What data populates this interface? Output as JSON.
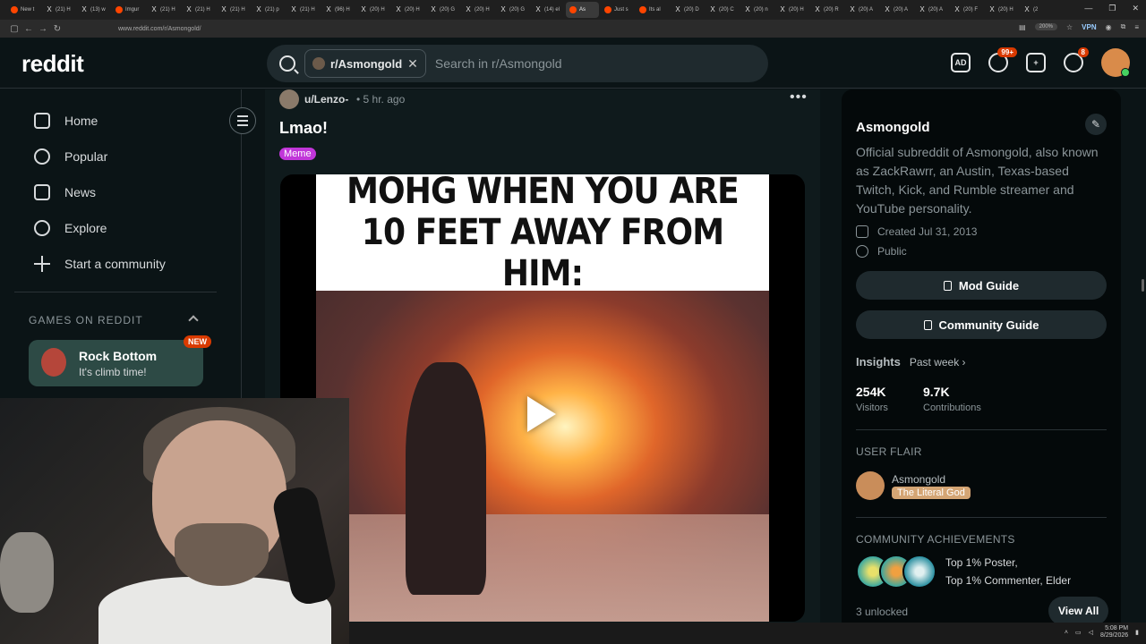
{
  "browser": {
    "tabs": [
      "New t",
      "(21) H",
      "(13) w",
      "Imgur",
      "(21) H",
      "(21) H",
      "(21) H",
      "(21) p",
      "(21) H",
      "(96) H",
      "(20) H",
      "(20) H",
      "(20) G",
      "(20) H",
      "(20) G",
      "(14) el",
      "As",
      "Just s",
      "Its al",
      "(20) D",
      "(20) C",
      "(20) n",
      "(20) H",
      "(20) R",
      "(20) A",
      "(20) A",
      "(20) A",
      "(20) F",
      "(20) H",
      "(2"
    ],
    "active_tab_index": 16,
    "url": "www.reddit.com/r/Asmongold/",
    "zoom": "200%",
    "vpn_label": "VPN"
  },
  "header": {
    "logo": "reddit",
    "search_chip": "r/Asmongold",
    "search_placeholder": "Search in r/Asmongold",
    "chat_badge": "99+",
    "notif_badge": "8",
    "ads_label": "AD"
  },
  "left_nav": {
    "items": [
      {
        "label": "Home",
        "icon": "home-icon"
      },
      {
        "label": "Popular",
        "icon": "popular-icon"
      },
      {
        "label": "News",
        "icon": "news-icon"
      },
      {
        "label": "Explore",
        "icon": "explore-icon"
      },
      {
        "label": "Start a community",
        "icon": "plus-icon"
      }
    ],
    "games_section": "GAMES ON REDDIT",
    "game": {
      "title": "Rock Bottom",
      "subtitle": "It's climb time!",
      "badge": "NEW"
    }
  },
  "post": {
    "author": "u/Lenzo-",
    "time": "• 5 hr. ago",
    "title": "Lmao!",
    "flair": "Meme",
    "meme_caption": "MOHG WHEN YOU ARE 10 FEET AWAY FROM HIM:"
  },
  "sidebar": {
    "name": "Asmongold",
    "description": "Official subreddit of Asmongold, also known as ZackRawrr, an Austin, Texas-based Twitch, Kick, and Rumble streamer and YouTube personality.",
    "created": "Created Jul 31, 2013",
    "visibility": "Public",
    "mod_guide": "Mod Guide",
    "community_guide": "Community Guide",
    "insights_title": "Insights",
    "insights_range": "Past week ›",
    "visitors_value": "254K",
    "visitors_label": "Visitors",
    "contrib_value": "9.7K",
    "contrib_label": "Contributions",
    "user_flair_title": "USER FLAIR",
    "flair_user": "Asmongold",
    "flair_tag": "The Literal God",
    "achievements_title": "COMMUNITY ACHIEVEMENTS",
    "achievement_line1": "Top 1% Poster,",
    "achievement_line2": "Top 1% Commenter, Elder",
    "unlocked": "3 unlocked",
    "view_all": "View All"
  },
  "taskbar": {
    "time": "5:08 PM",
    "date": "8/29/2026"
  },
  "colors": {
    "bg": "#0b1416",
    "accent": "#d93a00",
    "flair": "#c136d9",
    "game_card": "#2d4a45"
  }
}
